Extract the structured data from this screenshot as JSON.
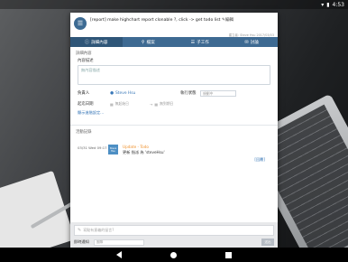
{
  "status_bar": {
    "time": "4:53"
  },
  "card": {
    "title": "[report] make highchart report clonable ?, click -> get todo list",
    "edit_label": "編輯",
    "meta": "建立者: Steve Hsu 2017/03/03"
  },
  "tabs": [
    {
      "label": "詳細內容",
      "icon": "info"
    },
    {
      "label": "檔案",
      "icon": "clip"
    },
    {
      "label": "子工作",
      "icon": "list"
    },
    {
      "label": "討論",
      "icon": "chat"
    }
  ],
  "details": {
    "section_label": "詳細內容",
    "desc_label": "內容描述",
    "desc_placeholder": "無內容描述",
    "assignee_label": "負責人",
    "assignee_value": "Steve Hsu",
    "exec_label": "執行狀態",
    "exec_placeholder": "規劃中",
    "date_label": "起迄日期",
    "start_placeholder": "無起始日",
    "end_placeholder": "無到期日",
    "advanced_link": "顯示進階設定..."
  },
  "activity": {
    "header": "活動記錄",
    "entries": [
      {
        "date": "03/31 Wed 09:17",
        "avatar_text": "Steve Hsu",
        "title": "Update - Todo",
        "body": "更新 指派 為 'steveHsu'"
      }
    ],
    "reply_link": "[回覆]"
  },
  "footer": {
    "comment_placeholder": "寫點有意義的留言?",
    "notify_label": "即時通知",
    "notify_placeholder": "團隊",
    "send_label": "送出"
  }
}
